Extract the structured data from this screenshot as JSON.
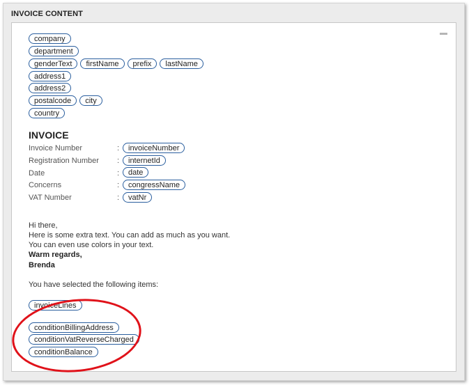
{
  "frame": {
    "title": "INVOICE CONTENT"
  },
  "address": {
    "company": "company",
    "department": "department",
    "genderText": "genderText",
    "firstName": "firstName",
    "prefix": "prefix",
    "lastName": "lastName",
    "address1": "address1",
    "address2": "address2",
    "postalcode": "postalcode",
    "city": "city",
    "country": "country"
  },
  "invoice": {
    "heading": "INVOICE",
    "fields": [
      {
        "label": "Invoice Number",
        "colon": ":",
        "value": "invoiceNumber"
      },
      {
        "label": "Registration Number",
        "colon": ":",
        "value": "internetId"
      },
      {
        "label": "Date",
        "colon": ":",
        "value": "date"
      },
      {
        "label": "Concerns",
        "colon": ":",
        "value": "congressName"
      },
      {
        "label": "VAT Number",
        "colon": ":",
        "value": "vatNr"
      }
    ]
  },
  "message": {
    "line1": "Hi there,",
    "line2": "Here is some extra text. You can add as much as you want.",
    "line3": "You can even use colors in your text.",
    "line4": "Warm regards,",
    "line5": "Brenda",
    "line6": "You have selected the following items:"
  },
  "items": {
    "invoiceLines": "invoiceLines",
    "conditions": [
      "conditionBillingAddress",
      "conditionVatReverseCharged",
      "conditionBalance"
    ]
  },
  "annotation": {
    "color": "#e0121a"
  }
}
